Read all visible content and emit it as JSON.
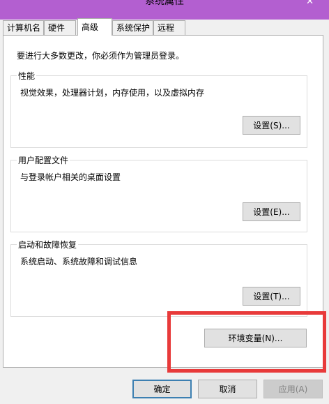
{
  "window": {
    "title": "系统属性",
    "close_glyph": "✕"
  },
  "tabs": [
    {
      "label": "计算机名",
      "active": false
    },
    {
      "label": "硬件",
      "active": false
    },
    {
      "label": "高级",
      "active": true
    },
    {
      "label": "系统保护",
      "active": false
    },
    {
      "label": "远程",
      "active": false
    }
  ],
  "advanced": {
    "intro": "要进行大多数更改，你必须作为管理员登录。",
    "performance": {
      "legend": "性能",
      "description": "视觉效果，处理器计划，内存使用，以及虚拟内存",
      "button": "设置(S)..."
    },
    "user_profiles": {
      "legend": "用户配置文件",
      "description": "与登录帐户相关的桌面设置",
      "button": "设置(E)..."
    },
    "startup_recovery": {
      "legend": "启动和故障恢复",
      "description": "系统启动、系统故障和调试信息",
      "button": "设置(T)..."
    },
    "env_vars_button": "环境变量(N)..."
  },
  "footer": {
    "ok": "确定",
    "cancel": "取消",
    "apply": "应用(A)"
  },
  "colors": {
    "titlebar": "#b35fd0",
    "highlight": "#e83a3a"
  }
}
